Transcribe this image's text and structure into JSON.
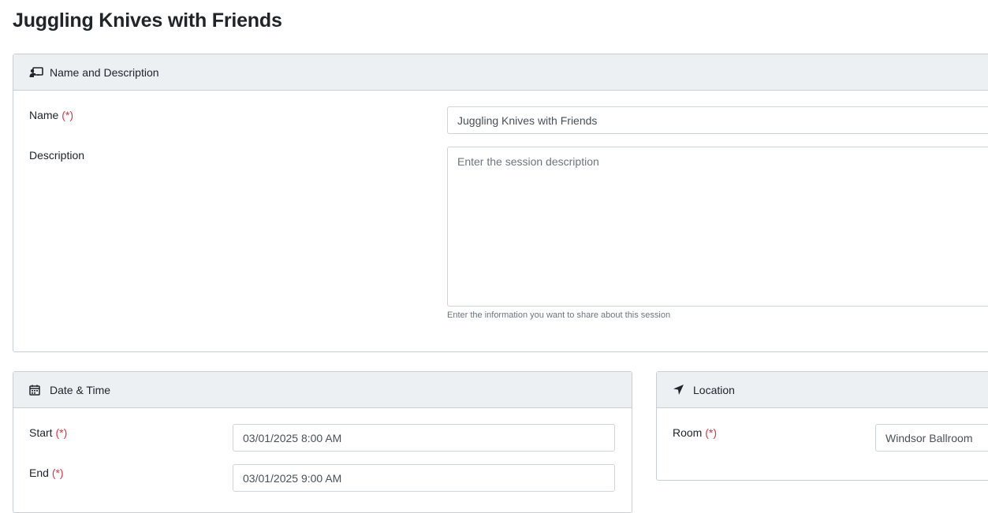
{
  "page": {
    "title": "Juggling Knives with Friends"
  },
  "required_marker": "(*)",
  "name_section": {
    "header": "Name and Description",
    "icon": "presentation-icon",
    "name_label": "Name",
    "name_value": "Juggling Knives with Friends",
    "description_label": "Description",
    "description_placeholder": "Enter the session description",
    "description_value": "",
    "description_help": "Enter the information you want to share about this session"
  },
  "datetime_section": {
    "header": "Date & Time",
    "icon": "calendar-icon",
    "start_label": "Start",
    "start_value": "03/01/2025 8:00 AM",
    "end_label": "End",
    "end_value": "03/01/2025 9:00 AM"
  },
  "location_section": {
    "header": "Location",
    "icon": "location-arrow-icon",
    "room_label": "Room",
    "room_value": "Windsor Ballroom"
  },
  "colors": {
    "required": "#dc3545",
    "header_bg": "#edf0f3",
    "border": "#c9ced3"
  }
}
